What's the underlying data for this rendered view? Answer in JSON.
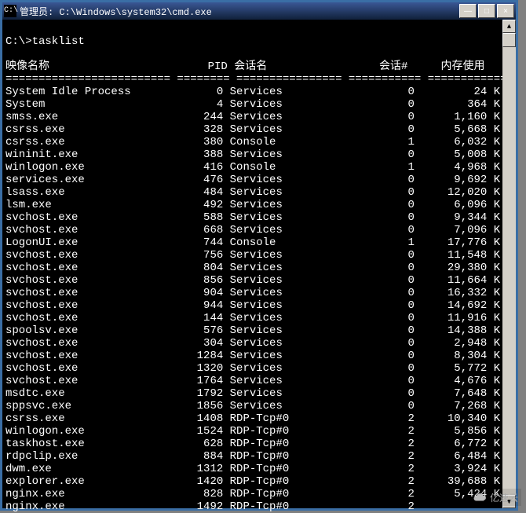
{
  "window": {
    "icon_glyph": "C:\\",
    "title": "管理员: C:\\Windows\\system32\\cmd.exe",
    "buttons": {
      "minimize": "—",
      "maximize": "□",
      "close": "×"
    }
  },
  "prompt": "C:\\>tasklist",
  "headers": {
    "image_name": "映像名称",
    "pid": "PID",
    "session_name": "会话名",
    "session_num": "会话#",
    "mem_usage": "内存使用"
  },
  "separator": "========================= ======== ================ =========== ============",
  "processes": [
    {
      "name": "System Idle Process",
      "pid": 0,
      "session": "Services",
      "snum": 0,
      "mem": "24 K"
    },
    {
      "name": "System",
      "pid": 4,
      "session": "Services",
      "snum": 0,
      "mem": "364 K"
    },
    {
      "name": "smss.exe",
      "pid": 244,
      "session": "Services",
      "snum": 0,
      "mem": "1,160 K"
    },
    {
      "name": "csrss.exe",
      "pid": 328,
      "session": "Services",
      "snum": 0,
      "mem": "5,668 K"
    },
    {
      "name": "csrss.exe",
      "pid": 380,
      "session": "Console",
      "snum": 1,
      "mem": "6,032 K"
    },
    {
      "name": "wininit.exe",
      "pid": 388,
      "session": "Services",
      "snum": 0,
      "mem": "5,008 K"
    },
    {
      "name": "winlogon.exe",
      "pid": 416,
      "session": "Console",
      "snum": 1,
      "mem": "4,968 K"
    },
    {
      "name": "services.exe",
      "pid": 476,
      "session": "Services",
      "snum": 0,
      "mem": "9,692 K"
    },
    {
      "name": "lsass.exe",
      "pid": 484,
      "session": "Services",
      "snum": 0,
      "mem": "12,020 K"
    },
    {
      "name": "lsm.exe",
      "pid": 492,
      "session": "Services",
      "snum": 0,
      "mem": "6,096 K"
    },
    {
      "name": "svchost.exe",
      "pid": 588,
      "session": "Services",
      "snum": 0,
      "mem": "9,344 K"
    },
    {
      "name": "svchost.exe",
      "pid": 668,
      "session": "Services",
      "snum": 0,
      "mem": "7,096 K"
    },
    {
      "name": "LogonUI.exe",
      "pid": 744,
      "session": "Console",
      "snum": 1,
      "mem": "17,776 K"
    },
    {
      "name": "svchost.exe",
      "pid": 756,
      "session": "Services",
      "snum": 0,
      "mem": "11,548 K"
    },
    {
      "name": "svchost.exe",
      "pid": 804,
      "session": "Services",
      "snum": 0,
      "mem": "29,380 K"
    },
    {
      "name": "svchost.exe",
      "pid": 856,
      "session": "Services",
      "snum": 0,
      "mem": "11,664 K"
    },
    {
      "name": "svchost.exe",
      "pid": 904,
      "session": "Services",
      "snum": 0,
      "mem": "16,332 K"
    },
    {
      "name": "svchost.exe",
      "pid": 944,
      "session": "Services",
      "snum": 0,
      "mem": "14,692 K"
    },
    {
      "name": "svchost.exe",
      "pid": 144,
      "session": "Services",
      "snum": 0,
      "mem": "11,916 K"
    },
    {
      "name": "spoolsv.exe",
      "pid": 576,
      "session": "Services",
      "snum": 0,
      "mem": "14,388 K"
    },
    {
      "name": "svchost.exe",
      "pid": 304,
      "session": "Services",
      "snum": 0,
      "mem": "2,948 K"
    },
    {
      "name": "svchost.exe",
      "pid": 1284,
      "session": "Services",
      "snum": 0,
      "mem": "8,304 K"
    },
    {
      "name": "svchost.exe",
      "pid": 1320,
      "session": "Services",
      "snum": 0,
      "mem": "5,772 K"
    },
    {
      "name": "svchost.exe",
      "pid": 1764,
      "session": "Services",
      "snum": 0,
      "mem": "4,676 K"
    },
    {
      "name": "msdtc.exe",
      "pid": 1792,
      "session": "Services",
      "snum": 0,
      "mem": "7,648 K"
    },
    {
      "name": "sppsvc.exe",
      "pid": 1856,
      "session": "Services",
      "snum": 0,
      "mem": "7,268 K"
    },
    {
      "name": "csrss.exe",
      "pid": 1408,
      "session": "RDP-Tcp#0",
      "snum": 2,
      "mem": "10,340 K"
    },
    {
      "name": "winlogon.exe",
      "pid": 1524,
      "session": "RDP-Tcp#0",
      "snum": 2,
      "mem": "5,856 K"
    },
    {
      "name": "taskhost.exe",
      "pid": 628,
      "session": "RDP-Tcp#0",
      "snum": 2,
      "mem": "6,772 K"
    },
    {
      "name": "rdpclip.exe",
      "pid": 884,
      "session": "RDP-Tcp#0",
      "snum": 2,
      "mem": "6,484 K"
    },
    {
      "name": "dwm.exe",
      "pid": 1312,
      "session": "RDP-Tcp#0",
      "snum": 2,
      "mem": "3,924 K"
    },
    {
      "name": "explorer.exe",
      "pid": 1420,
      "session": "RDP-Tcp#0",
      "snum": 2,
      "mem": "39,688 K"
    },
    {
      "name": "nginx.exe",
      "pid": 828,
      "session": "RDP-Tcp#0",
      "snum": 2,
      "mem": "5,424 K"
    },
    {
      "name": "nginx.exe",
      "pid": 1492,
      "session": "RDP-Tcp#0",
      "snum": 2,
      "mem": ""
    }
  ],
  "watermark": "亿速云"
}
